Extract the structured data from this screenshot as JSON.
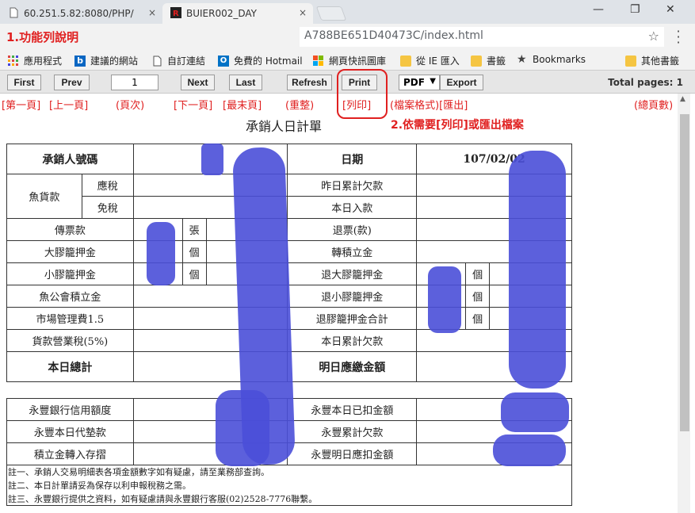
{
  "browser": {
    "tabs": [
      {
        "label": "60.251.5.82:8080/PHP/",
        "close": "×"
      },
      {
        "label": "BUIER002_DAY",
        "close": "×"
      }
    ],
    "window_controls": {
      "minimize": "—",
      "restore": "❐",
      "close": "✕"
    },
    "address": "A788BE651D40473C/index.html",
    "star": "☆",
    "menu": "⋮",
    "bookmarks": [
      {
        "label": "應用程式",
        "icon": "apps-icon"
      },
      {
        "label": "建議的網站",
        "icon": "bing-icon"
      },
      {
        "label": "自訂連結",
        "icon": "page-icon"
      },
      {
        "label": "免費的 Hotmail",
        "icon": "outlook-icon"
      },
      {
        "label": "網頁快訊圖庫",
        "icon": "windows-icon"
      },
      {
        "label": "從 IE 匯入",
        "icon": "folder-icon"
      },
      {
        "label": "書籤",
        "icon": "folder-icon"
      },
      {
        "label": "Bookmarks",
        "icon": "star-icon"
      },
      {
        "label": "其他書籤",
        "icon": "folder-icon"
      }
    ]
  },
  "annotations": {
    "title1": "1.功能列說明",
    "title2": "2.依需要[列印]或匯出檔案",
    "first": "[第一頁]",
    "prev": "[上一頁]",
    "page": "(頁次)",
    "next": "[下一頁]",
    "last": "[最末頁]",
    "refresh": "(重整)",
    "print": "[列印]",
    "format_export": "(檔案格式)[匯出]",
    "total": "(總頁數)",
    "accent_color": "#e02020"
  },
  "toolbar": {
    "first": "First",
    "prev": "Prev",
    "page_value": "1",
    "next": "Next",
    "last": "Last",
    "refresh": "Refresh",
    "print": "Print",
    "format": "PDF",
    "export": "Export",
    "total_pages": "Total pages: 1"
  },
  "report": {
    "title": "承銷人日計單",
    "table1": {
      "underwriter_no": "承銷人號碼",
      "date_label": "日期",
      "date_value": "107/02/02",
      "fish_payment": "魚貨款",
      "taxable": "應稅",
      "tax_free": "免稅",
      "prev_arrears": "昨日累計欠款",
      "today_income": "本日入款",
      "ticket_payment": "傳票款",
      "unit_sheet": "張",
      "refund": "退票(款)",
      "large_cage_deposit": "大膠籠押金",
      "unit_piece": "個",
      "transfer_savings": "轉積立金",
      "small_cage_deposit": "小膠籠押金",
      "return_large_cage": "退大膠籠押金",
      "fish_assoc_savings": "魚公會積立金",
      "return_small_cage": "退小膠籠押金",
      "market_fee": "市場管理費1.5",
      "return_cage_total": "退膠籠押金合計",
      "business_tax": "貨款營業稅(5%)",
      "today_arrears": "本日累計欠款",
      "today_total": "本日總計",
      "tomorrow_due": "明日應繳金額"
    },
    "table2": {
      "credit_limit": "永豐銀行信用額度",
      "deducted_today": "永豐本日已扣金額",
      "advance_today": "永豐本日代墊款",
      "accum_arrears": "永豐累計欠款",
      "savings_deposit": "積立金轉入存摺",
      "deduct_tomorrow": "永豐明日應扣金額"
    },
    "footnotes": [
      "註一、承銷人交易明細表各項金額數字如有疑慮，請至業務部查詢。",
      "註二、本日計單請妥為保存以利申報稅務之需。",
      "註三、永豐銀行提供之資料，如有疑慮請與永豐銀行客服(02)2528-7776聯繫。"
    ]
  }
}
